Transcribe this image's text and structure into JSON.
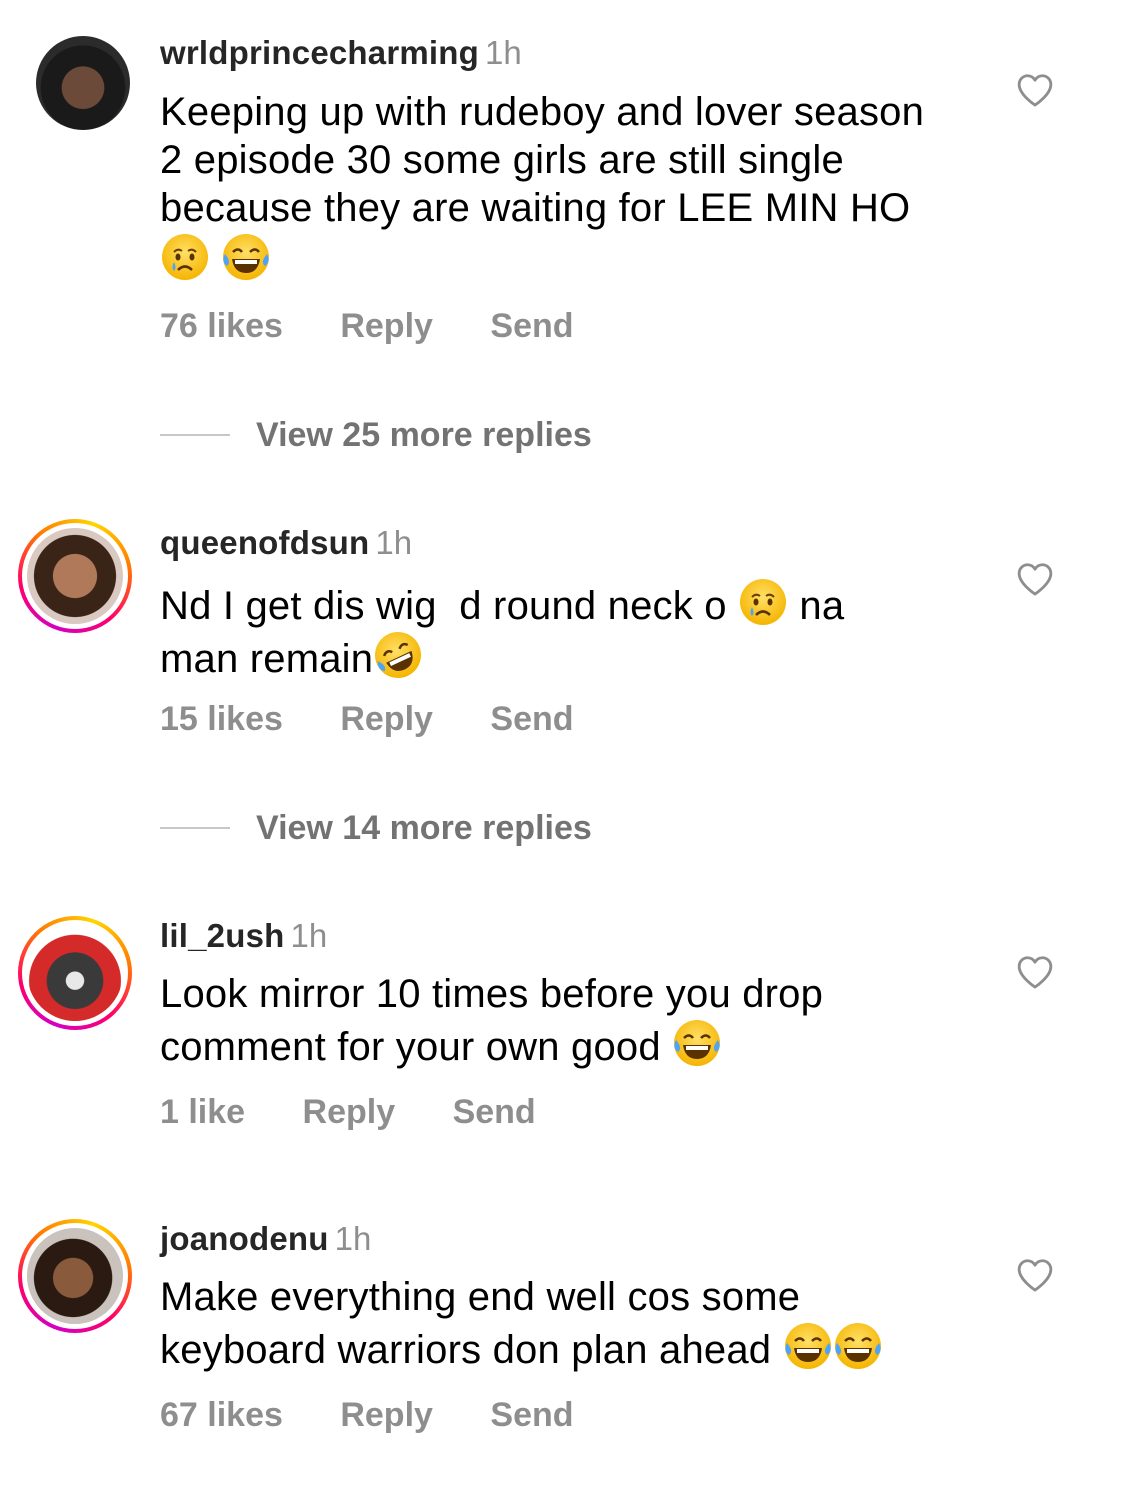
{
  "comments": [
    {
      "username": "wrldprincecharming",
      "time": "1h",
      "text_parts": [
        "Keeping up with rudeboy and lover season 2 episode 30 some girls are still single because they are waiting for LEE MIN HO"
      ],
      "emojis": [
        "crying-face",
        "tears-of-joy"
      ],
      "likes": "76 likes",
      "reply": "Reply",
      "send": "Send",
      "view_replies": "View 25 more replies"
    },
    {
      "username": "queenofdsun",
      "time": "1h",
      "text_a": "Nd I get dis wig  d round neck o",
      "text_b": "na",
      "text_c": "man remain",
      "emojis": [
        "crying-face",
        "rolling-laughing"
      ],
      "likes": "15 likes",
      "reply": "Reply",
      "send": "Send",
      "view_replies": "View 14 more replies"
    },
    {
      "username": "lil_2ush",
      "time": "1h",
      "text_a": "Look mirror 10 times before you drop",
      "text_b": "comment for your own good",
      "emojis": [
        "tears-of-joy"
      ],
      "likes": "1 like",
      "reply": "Reply",
      "send": "Send"
    },
    {
      "username": "joanodenu",
      "time": "1h",
      "text_a": "Make everything end well cos some",
      "text_b": "keyboard warriors don plan ahead",
      "emojis": [
        "tears-of-joy",
        "tears-of-joy"
      ],
      "likes": "67 likes",
      "reply": "Reply",
      "send": "Send"
    }
  ],
  "colors": {
    "primary_text": "#000000",
    "secondary_text": "#8e8e8e",
    "story_ring_start": "#d300c5",
    "story_ring_end": "#ffd600"
  },
  "icons": [
    "heart-icon",
    "crying-face-emoji",
    "tears-of-joy-emoji",
    "rolling-laughing-emoji"
  ]
}
